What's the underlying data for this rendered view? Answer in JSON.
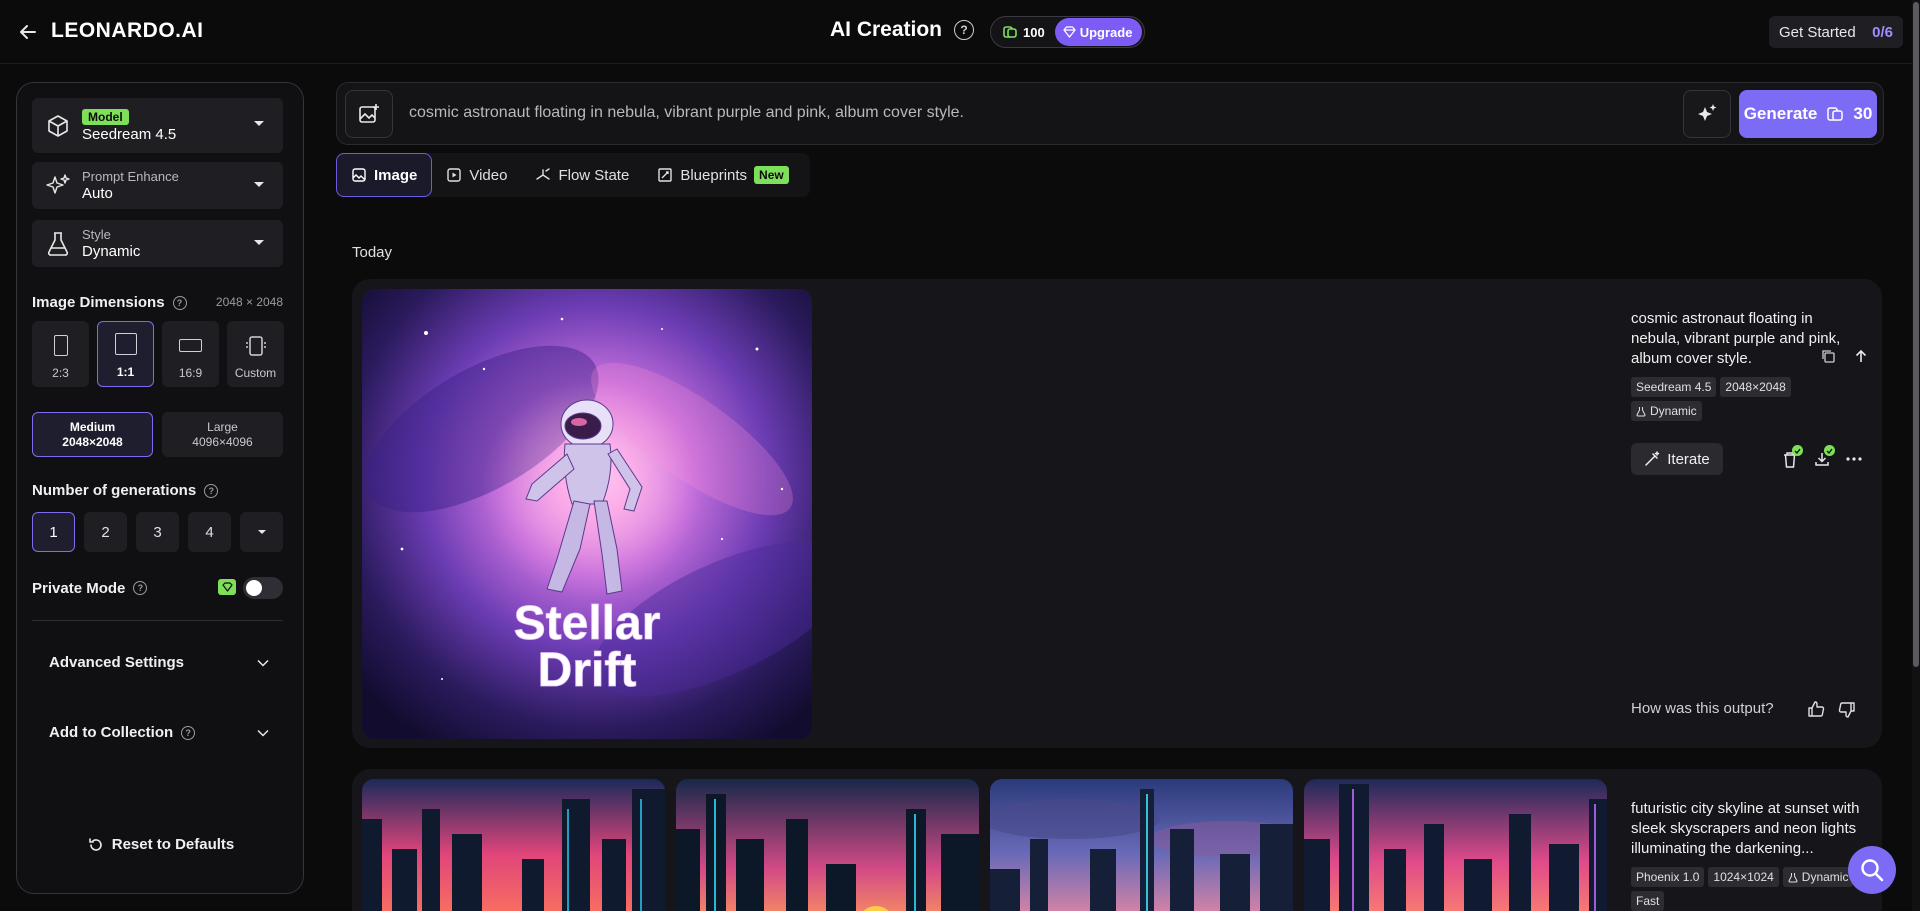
{
  "header": {
    "brand": "LEONARDO.AI",
    "title": "AI Creation",
    "help": "?",
    "credits": "100",
    "upgrade_label": "Upgrade",
    "get_started_label": "Get Started",
    "get_started_count": "0/6"
  },
  "sidebar": {
    "model": {
      "badge": "Model",
      "value": "Seedream 4.5"
    },
    "prompt_enhance": {
      "label": "Prompt Enhance",
      "value": "Auto"
    },
    "style": {
      "label": "Style",
      "value": "Dynamic"
    },
    "dimensions": {
      "title": "Image Dimensions",
      "current": "2048 × 2048",
      "ratios": [
        "2:3",
        "1:1",
        "16:9",
        "Custom"
      ],
      "selected_ratio": "1:1",
      "sizes": [
        {
          "name": "Medium",
          "res": "2048×2048"
        },
        {
          "name": "Large",
          "res": "4096×4096"
        }
      ],
      "selected_size": "Medium"
    },
    "generations": {
      "title": "Number of generations",
      "options": [
        "1",
        "2",
        "3",
        "4"
      ],
      "selected": "1"
    },
    "private_mode": {
      "label": "Private Mode",
      "enabled": false
    },
    "advanced_label": "Advanced Settings",
    "collection_label": "Add to Collection",
    "reset_label": "Reset to Defaults"
  },
  "prompt": {
    "text": "cosmic astronaut floating in nebula, vibrant purple and pink, album cover style.",
    "generate_label": "Generate",
    "generate_cost": "30"
  },
  "tabs": [
    {
      "label": "Image",
      "icon": "image-icon",
      "active": true
    },
    {
      "label": "Video",
      "icon": "video-icon",
      "active": false
    },
    {
      "label": "Flow State",
      "icon": "flow-icon",
      "active": false
    },
    {
      "label": "Blueprints",
      "icon": "blueprint-icon",
      "active": false,
      "badge": "New"
    }
  ],
  "feed": {
    "section": "Today",
    "results": [
      {
        "image_text_line1": "Stellar",
        "image_text_line2": "Drift",
        "prompt": "cosmic astronaut floating in nebula, vibrant purple and pink, album cover style.",
        "tags": [
          "Seedream 4.5",
          "2048×2048",
          "Dynamic"
        ],
        "iterate_label": "Iterate",
        "feedback_prompt": "How was this output?"
      },
      {
        "prompt": "futuristic city skyline at sunset with sleek skyscrapers and neon lights illuminating the darkening...",
        "tags": [
          "Phoenix 1.0",
          "1024×1024",
          "Dynamic",
          "Fast"
        ]
      }
    ]
  },
  "colors": {
    "accent": "#7c6cf5",
    "badge_green": "#7ee05a",
    "background": "#0b0b0c"
  }
}
